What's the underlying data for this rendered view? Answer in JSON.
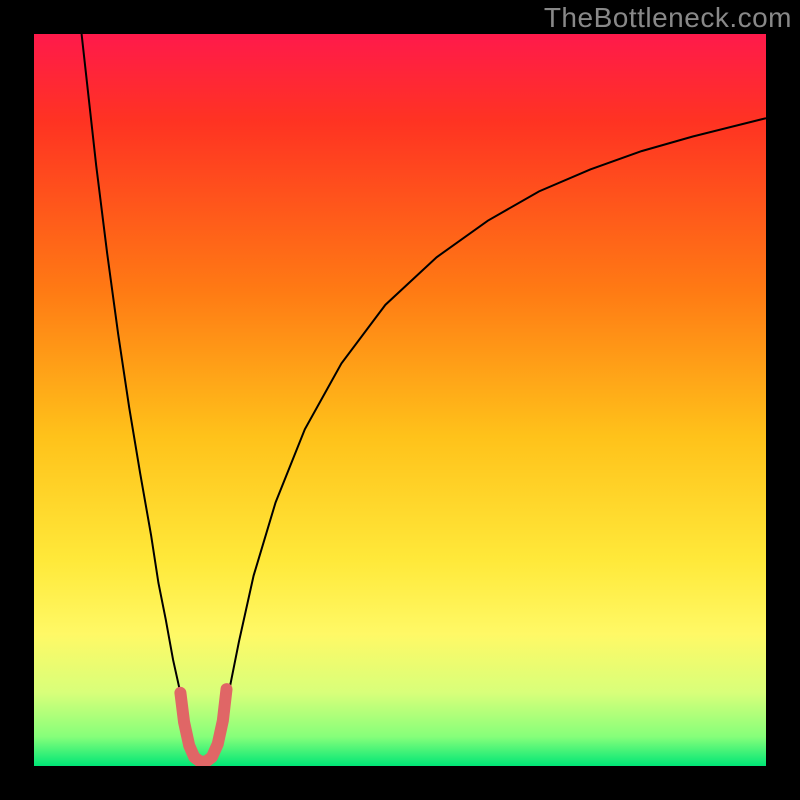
{
  "watermark": "TheBottleneck.com",
  "chart_data": {
    "type": "line",
    "title": "",
    "xlabel": "",
    "ylabel": "",
    "xlim": [
      0,
      100
    ],
    "ylim": [
      0,
      100
    ],
    "grid": false,
    "legend": false,
    "background_gradient_stops": [
      {
        "offset": 0.0,
        "color": "#ff1a4b"
      },
      {
        "offset": 0.12,
        "color": "#ff3322"
      },
      {
        "offset": 0.35,
        "color": "#ff7a14"
      },
      {
        "offset": 0.55,
        "color": "#ffc21a"
      },
      {
        "offset": 0.72,
        "color": "#ffe93a"
      },
      {
        "offset": 0.82,
        "color": "#fff966"
      },
      {
        "offset": 0.9,
        "color": "#d8ff7a"
      },
      {
        "offset": 0.96,
        "color": "#86ff7a"
      },
      {
        "offset": 1.0,
        "color": "#00e676"
      }
    ],
    "series": [
      {
        "name": "curve-left",
        "color": "#000000",
        "stroke_width": 2,
        "x": [
          6.5,
          7.5,
          8.5,
          10,
          11.5,
          13,
          14.5,
          16,
          17,
          18,
          19,
          20,
          20.8,
          21.3,
          21.8,
          22.2
        ],
        "y": [
          100,
          91,
          82,
          70,
          59,
          49,
          40,
          31.5,
          25,
          20,
          14.5,
          10,
          6,
          3.5,
          1.5,
          0.5
        ]
      },
      {
        "name": "curve-right",
        "color": "#000000",
        "stroke_width": 2,
        "x": [
          24.2,
          24.8,
          25.6,
          26.6,
          28,
          30,
          33,
          37,
          42,
          48,
          55,
          62,
          69,
          76,
          83,
          90,
          96,
          100
        ],
        "y": [
          0.5,
          2,
          5,
          10,
          17,
          26,
          36,
          46,
          55,
          63,
          69.5,
          74.5,
          78.5,
          81.5,
          84,
          86,
          87.5,
          88.5
        ]
      },
      {
        "name": "valley-marker",
        "color": "#e06666",
        "stroke_width": 12,
        "linecap": "round",
        "x": [
          20.0,
          20.5,
          21.2,
          21.9,
          22.7,
          23.5,
          24.3,
          25.1,
          25.8,
          26.3
        ],
        "y": [
          10.0,
          6.0,
          2.8,
          1.2,
          0.6,
          0.6,
          1.2,
          3.0,
          6.2,
          10.5
        ]
      }
    ]
  }
}
